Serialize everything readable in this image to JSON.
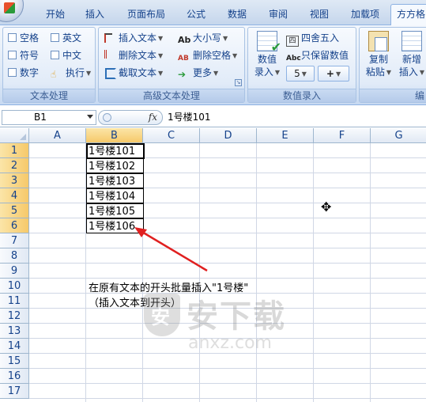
{
  "tabs": [
    "开始",
    "插入",
    "页面布局",
    "公式",
    "数据",
    "审阅",
    "视图",
    "加载项",
    "方方格"
  ],
  "active_tab_index": 8,
  "ribbon": {
    "text_group": {
      "label": "文本处理",
      "items": [
        "空格",
        "英文",
        "符号",
        "中文",
        "数字",
        "执行"
      ]
    },
    "adv_group": {
      "label": "高级文本处理",
      "items": [
        "插入文本",
        "删除文本",
        "截取文本",
        "大小写",
        "删除空格",
        "更多"
      ],
      "case_icon_text": "Ab",
      "space_icon_text": "AB"
    },
    "num_group": {
      "label": "数值录入",
      "value_entry_line1": "数值",
      "value_entry_line2": "录入",
      "round_label": "四舍五入",
      "round_icon_text": "四",
      "keep_value_label": "只保留数值",
      "keep_value_icon_text": "Abc",
      "small_btn_1": "5",
      "small_btn_2": "+"
    },
    "paste_group": {
      "copy_line1": "复制",
      "copy_line2": "粘贴",
      "new_line1": "新增",
      "new_line2": "插入",
      "partial_label": "编"
    }
  },
  "formula_bar": {
    "name_box": "B1",
    "fx": "fx",
    "value": "1号楼101"
  },
  "sheet": {
    "columns": [
      "A",
      "B",
      "C",
      "D",
      "E",
      "F",
      "G"
    ],
    "selected_column": "B",
    "rows": [
      "1",
      "2",
      "3",
      "4",
      "5",
      "6",
      "7",
      "8",
      "9",
      "10",
      "11",
      "12",
      "13",
      "14",
      "15",
      "16",
      "17"
    ],
    "b_values": [
      "1号楼101",
      "1号楼102",
      "1号楼103",
      "1号楼104",
      "1号楼105",
      "1号楼106"
    ],
    "note_line1": "在原有文本的开头批量插入\"1号楼\"",
    "note_line2": "（插入文本到开头）"
  },
  "watermark": {
    "cn": "安下载",
    "en": "anxz.com"
  },
  "colors": {
    "accent_blue": "#15428b",
    "arrow_red": "#e02020",
    "selection_header": "#f6c96a"
  }
}
